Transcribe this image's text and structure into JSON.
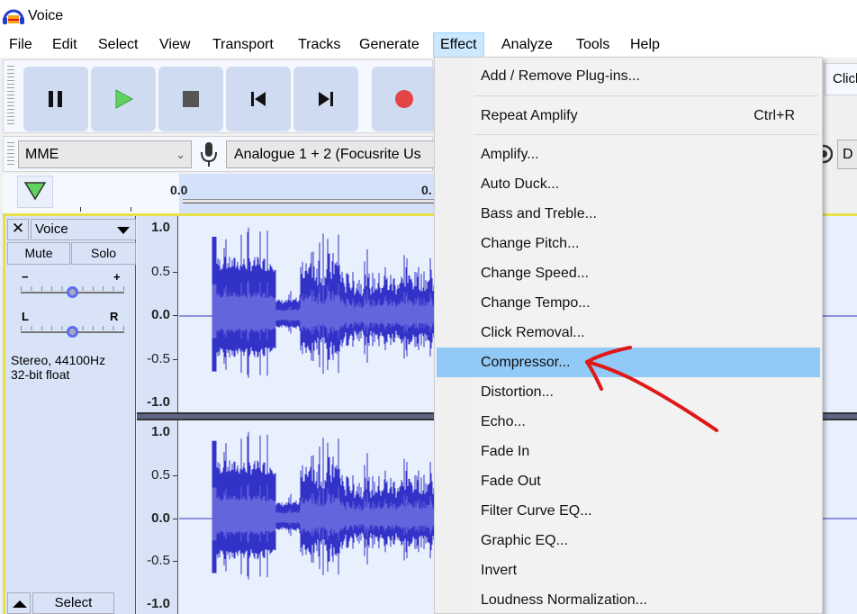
{
  "window": {
    "title": "Voice"
  },
  "menubar": {
    "items": [
      "File",
      "Edit",
      "Select",
      "View",
      "Transport",
      "Tracks",
      "Generate",
      "Effect",
      "Analyze",
      "Tools",
      "Help"
    ],
    "open_index": 7
  },
  "transport": {
    "buttons": [
      {
        "name": "pause",
        "icon": "pause-icon"
      },
      {
        "name": "play",
        "icon": "play-icon"
      },
      {
        "name": "stop",
        "icon": "stop-icon"
      },
      {
        "name": "skip-to-start",
        "icon": "skip-start-icon"
      },
      {
        "name": "skip-to-end",
        "icon": "skip-end-icon"
      },
      {
        "name": "record",
        "icon": "record-icon"
      }
    ],
    "colors": {
      "play": "#4cc94c",
      "record": "#e34545",
      "button_bg": "#cfdbf1"
    }
  },
  "device": {
    "host": "MME",
    "recording_device": "Analogue 1 + 2 (Focusrite Us",
    "playback_partial": "D"
  },
  "edit_toolbar": {
    "click_hint": "Click"
  },
  "timeline": {
    "labels": [
      "0.0",
      "0."
    ]
  },
  "track": {
    "name": "Voice",
    "close_label": "✕",
    "mute_label": "Mute",
    "solo_label": "Solo",
    "gain": {
      "min_label": "−",
      "max_label": "+",
      "value_fraction": 0.5
    },
    "pan": {
      "left_label": "L",
      "right_label": "R",
      "value_fraction": 0.5
    },
    "info_line1": "Stereo, 44100Hz",
    "info_line2": "32-bit float",
    "select_label": "Select",
    "amplitude_labels": [
      "1.0",
      "0.5",
      "0.0",
      "-0.5",
      "-1.0"
    ],
    "waveform_color": "#3232c8",
    "waveform_rms_color": "#6464dc"
  },
  "effect_menu": {
    "items": [
      {
        "label": "Add / Remove Plug-ins...",
        "shortcut": ""
      },
      {
        "separator": true
      },
      {
        "label": "Repeat Amplify",
        "shortcut": "Ctrl+R"
      },
      {
        "separator": true
      },
      {
        "label": "Amplify...",
        "shortcut": ""
      },
      {
        "label": "Auto Duck...",
        "shortcut": ""
      },
      {
        "label": "Bass and Treble...",
        "shortcut": ""
      },
      {
        "label": "Change Pitch...",
        "shortcut": ""
      },
      {
        "label": "Change Speed...",
        "shortcut": ""
      },
      {
        "label": "Change Tempo...",
        "shortcut": ""
      },
      {
        "label": "Click Removal...",
        "shortcut": ""
      },
      {
        "label": "Compressor...",
        "shortcut": "",
        "highlighted": true
      },
      {
        "label": "Distortion...",
        "shortcut": ""
      },
      {
        "label": "Echo...",
        "shortcut": ""
      },
      {
        "label": "Fade In",
        "shortcut": ""
      },
      {
        "label": "Fade Out",
        "shortcut": ""
      },
      {
        "label": "Filter Curve EQ...",
        "shortcut": ""
      },
      {
        "label": "Graphic EQ...",
        "shortcut": ""
      },
      {
        "label": "Invert",
        "shortcut": ""
      },
      {
        "label": "Loudness Normalization...",
        "shortcut": ""
      }
    ],
    "highlight_color": "#91c9f7"
  },
  "annotation": {
    "type": "hand-drawn arrow",
    "points_to": "Compressor...",
    "color": "#e01818"
  }
}
